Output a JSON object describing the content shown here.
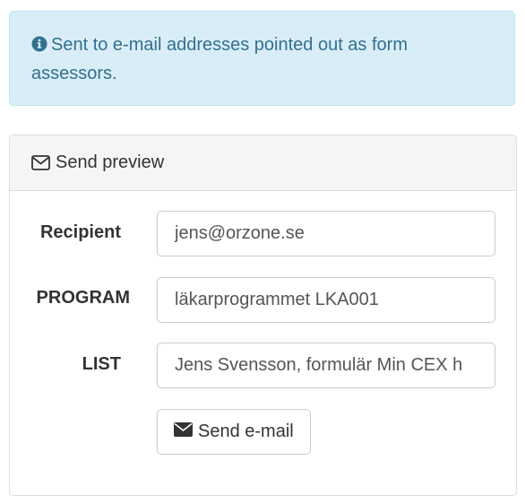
{
  "alert": {
    "icon": "info-circle-icon",
    "text": "Sent to e-mail addresses pointed out as form assessors.",
    "color": "#31708f",
    "background": "#d9edf7"
  },
  "panel": {
    "heading_icon": "envelope-outline-icon",
    "heading": "Send preview"
  },
  "form": {
    "recipient_label": "Recipient",
    "recipient_value": "jens@orzone.se",
    "program_label": "PROGRAM",
    "program_value": "läkarprogrammet LKA001",
    "list_label": "LIST",
    "list_value": "Jens Svensson, formulär Min CEX h",
    "submit_icon": "envelope-solid-icon",
    "submit_label": "Send e-mail"
  }
}
